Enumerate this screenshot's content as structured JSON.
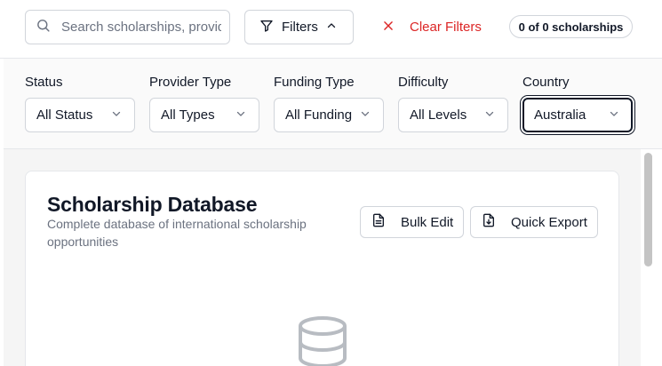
{
  "search": {
    "placeholder": "Search scholarships, providers...",
    "value": ""
  },
  "toolbar": {
    "filters_label": "Filters",
    "clear_label": "Clear Filters",
    "count_label": "0 of 0 scholarships"
  },
  "filters": [
    {
      "label": "Status",
      "value": "All Status"
    },
    {
      "label": "Provider Type",
      "value": "All Types"
    },
    {
      "label": "Funding Type",
      "value": "All Funding"
    },
    {
      "label": "Difficulty",
      "value": "All Levels"
    },
    {
      "label": "Country",
      "value": "Australia"
    }
  ],
  "card": {
    "title": "Scholarship Database",
    "subtitle": "Complete database of international scholarship opportunities",
    "bulk_edit_label": "Bulk Edit",
    "quick_export_label": "Quick Export"
  },
  "icons": {
    "search": "search-icon",
    "filters": "funnel-icon",
    "clear": "x-icon",
    "chevron": "chevron-down-icon",
    "bulk_edit": "file-text-icon",
    "export": "file-download-icon",
    "empty_state": "database-icon"
  },
  "colors": {
    "danger": "#dc2626",
    "text": "#111827",
    "muted": "#6b7280",
    "border": "#d1d5db"
  }
}
